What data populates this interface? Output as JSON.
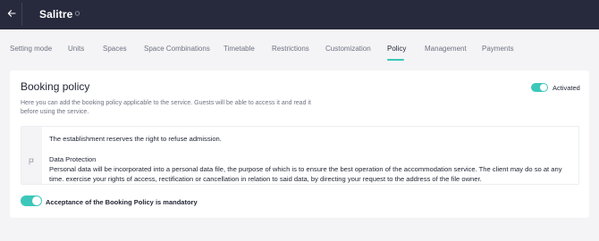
{
  "header": {
    "back_icon": "arrow-left-icon",
    "title": "Salitre",
    "title_icon": "edit-icon"
  },
  "tabs": [
    {
      "label": "Setting mode"
    },
    {
      "label": "Units"
    },
    {
      "label": "Spaces"
    },
    {
      "label": "Space Combinations"
    },
    {
      "label": "Timetable"
    },
    {
      "label": "Restrictions"
    },
    {
      "label": "Customization"
    },
    {
      "label": "Policy"
    },
    {
      "label": "Management"
    },
    {
      "label": "Payments"
    }
  ],
  "active_tab": "Policy",
  "policy": {
    "title": "Booking policy",
    "description": "Here you can add the booking policy applicable to the service. Guests will be able to access it and read it before using the service.",
    "activated_label": "Activated",
    "activated": true,
    "editor": {
      "gutter_icon": "flag-icon",
      "line1": "The establishment reserves the right to refuse admission.",
      "line2": "Data Protection",
      "line3": "Personal data will be incorporated into a personal data file, the purpose of which is to ensure the best operation of the accommodation service. The client may do so at any time. exercise your rights of access, rectification or cancellation in relation to said data, by directing your request to the address of the file owner."
    },
    "mandatory_label": "Acceptance of the Booking Policy is mandatory",
    "mandatory": true
  },
  "colors": {
    "header_bg": "#272a3d",
    "accent": "#3cc7ba",
    "page_bg": "#f4f4f6"
  }
}
